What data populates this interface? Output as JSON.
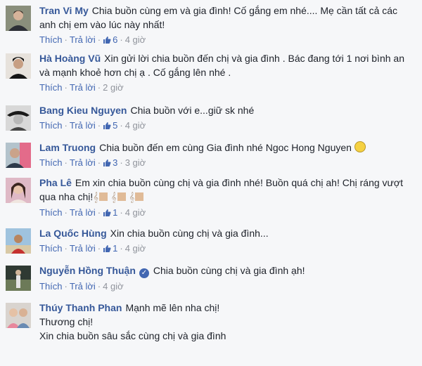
{
  "comments": [
    {
      "author": "Tran Vi My",
      "text": "Chia buồn cùng em và gia đình! Cố gắng em nhé.... Mẹ cần tất cả các anh chị em vào lúc này nhất!",
      "like": "Thích",
      "reply": "Trả lời",
      "likes": "6",
      "time": "4 giờ"
    },
    {
      "author": "Hà Hoàng Vũ",
      "text": "Xin gửi lời chia buồn đến chị và gia đình . Bác đang tới 1 nơi bình an và mạnh khoẻ hơn chị ạ . Cố gắng lên nhé .",
      "like": "Thích",
      "reply": "Trả lời",
      "time": "2 giờ"
    },
    {
      "author": "Bang Kieu Nguyen",
      "text": "Chia buồn với e...giữ sk nhé",
      "like": "Thích",
      "reply": "Trả lời",
      "likes": "5",
      "time": "4 giờ"
    },
    {
      "author": "Lam Truong",
      "text": "Chia buồn đến em cùng Gia đình nhé Ngoc Hong Nguyen",
      "like": "Thích",
      "reply": "Trả lời",
      "likes": "3",
      "time": "3 giờ"
    },
    {
      "author": "Pha Lê",
      "text": "Em xin chia buồn cùng chị và gia đình nhé! Buồn quá chị ah! Chị ráng vượt qua nha chị!",
      "like": "Thích",
      "reply": "Trả lời",
      "likes": "1",
      "time": "4 giờ"
    },
    {
      "author": "La Quốc Hùng",
      "text": "Xin chia buồn cùng chị và gia đình...",
      "like": "Thích",
      "reply": "Trả lời",
      "likes": "1",
      "time": "4 giờ"
    },
    {
      "author": "Nguyễn Hồng Thuận",
      "text": "Chia buồn cùng chị và gia đình ạh!",
      "like": "Thích",
      "reply": "Trả lời",
      "time": "4 giờ"
    },
    {
      "author": "Thúy Thanh Phan",
      "text": "Mạnh mẽ lên nha chị!",
      "line2": "Thương chị!",
      "line3": "Xin chia buồn sâu sắc cùng chị và gia đình"
    }
  ]
}
